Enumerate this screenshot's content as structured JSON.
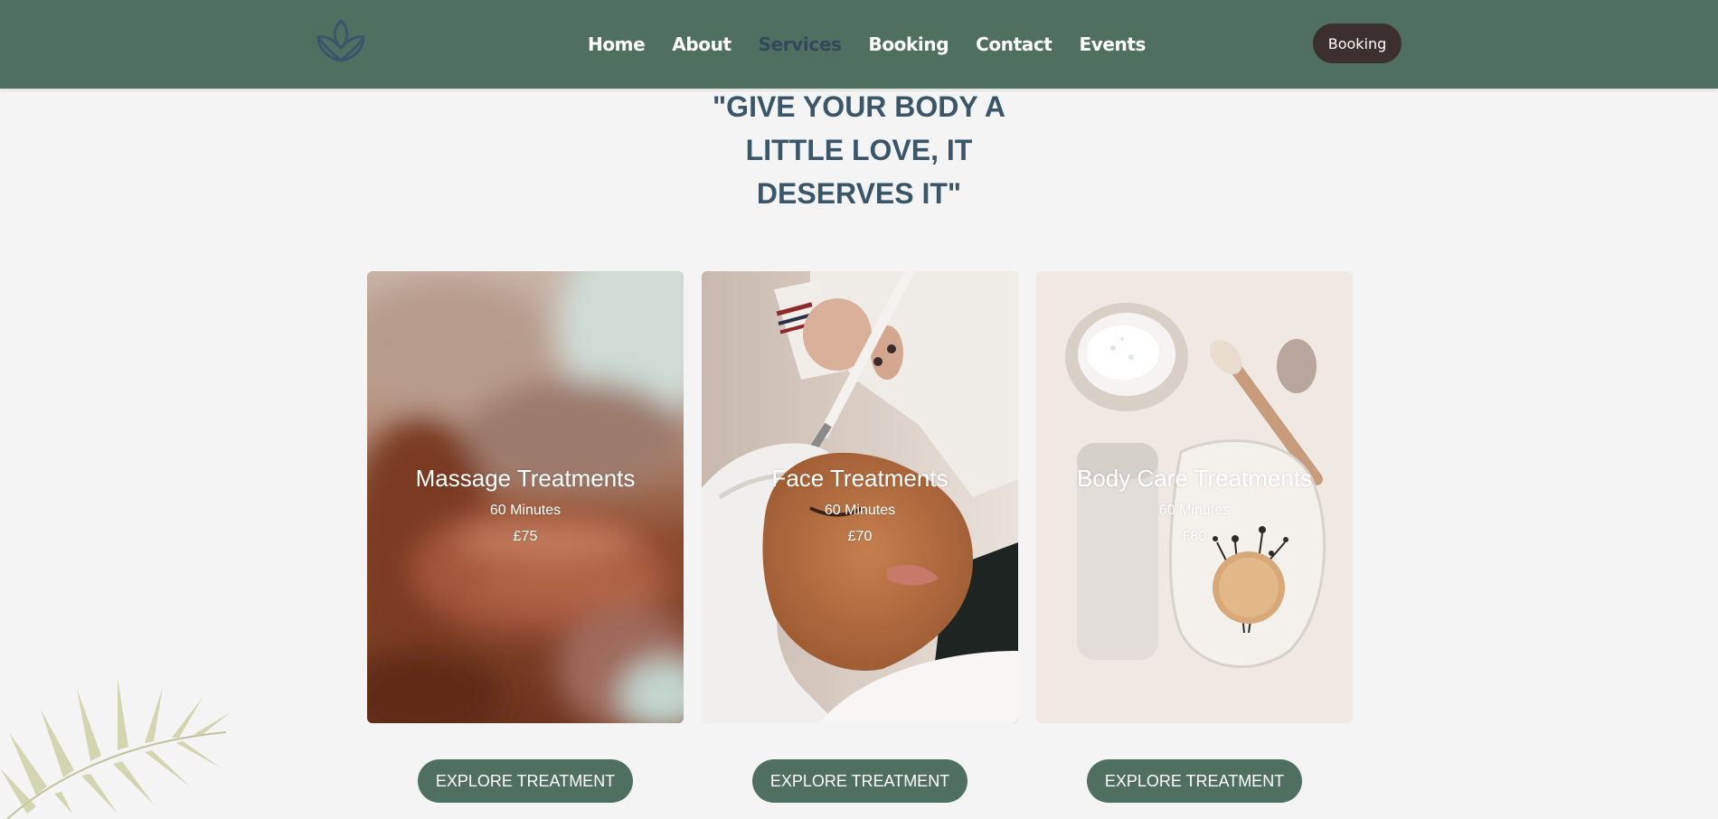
{
  "header": {
    "logo_icon": "lotus-icon",
    "nav": [
      {
        "label": "Home",
        "active": false
      },
      {
        "label": "About",
        "active": false
      },
      {
        "label": "Services",
        "active": true
      },
      {
        "label": "Booking",
        "active": false
      },
      {
        "label": "Contact",
        "active": false
      },
      {
        "label": "Events",
        "active": false
      }
    ],
    "cta_label": "Booking"
  },
  "hero": {
    "quote_lines": [
      "\"GIVE YOUR BODY A",
      "LITTLE LOVE, IT",
      "DESERVES IT\""
    ]
  },
  "treatments": [
    {
      "title": "Massage Treatments",
      "duration": "60 Minutes",
      "price": "£75",
      "button_label": "EXPLORE TREATMENT"
    },
    {
      "title": "Face Treatments",
      "duration": "60 Minutes",
      "price": "£70",
      "button_label": "EXPLORE TREATMENT"
    },
    {
      "title": "Body Care Treatments",
      "duration": "60 Minutes",
      "price": "£80",
      "button_label": "EXPLORE TREATMENT"
    }
  ],
  "colors": {
    "header_bg": "#4f6f60",
    "nav_active": "#33495a",
    "cta_bg": "#3b2f2f",
    "quote_text": "#3b5569",
    "page_bg": "#f4f4f4",
    "button_bg": "#4f6f60"
  },
  "decorations": {
    "palm_leaf": "palm-leaf-decoration"
  }
}
